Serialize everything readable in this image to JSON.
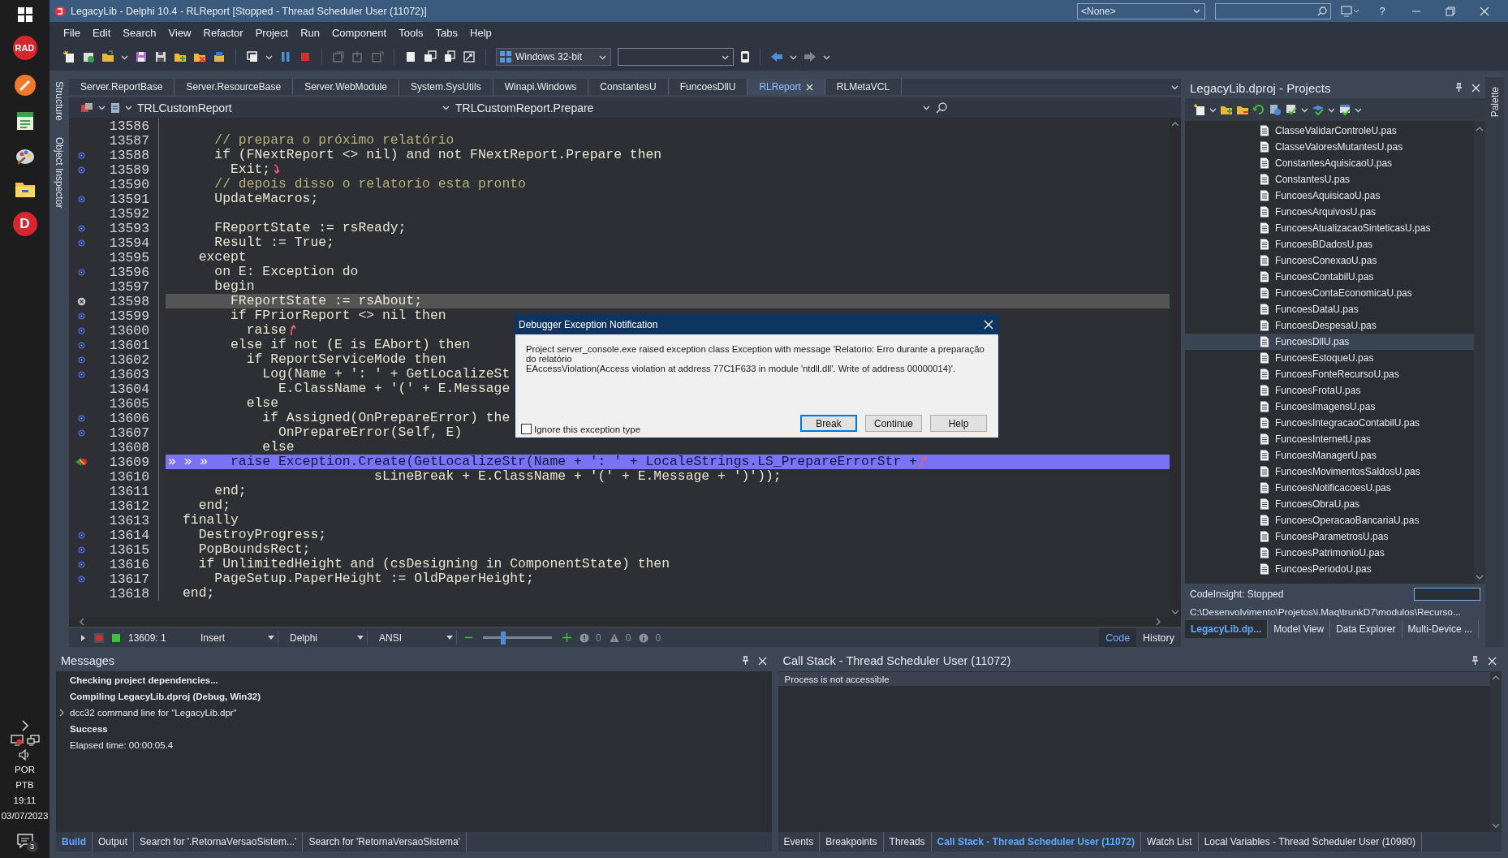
{
  "taskbar": {
    "rad_logo": "RAD",
    "d_logo": "D",
    "language": "POR",
    "region": "PTB",
    "time": "19:11",
    "date": "03/07/2023",
    "notifications": "3"
  },
  "window": {
    "title": "LegacyLib - Delphi 10.4 - RLReport [Stopped - Thread Scheduler User (11072)]",
    "config": "<None>",
    "help": "?"
  },
  "menu": [
    "File",
    "Edit",
    "Search",
    "View",
    "Refactor",
    "Project",
    "Run",
    "Component",
    "Tools",
    "Tabs",
    "Help"
  ],
  "toolbar": {
    "platform": "Windows 32-bit"
  },
  "side_tabs": [
    "Structure",
    "Object Inspector"
  ],
  "editor": {
    "tabs": [
      {
        "label": "Server.ReportBase",
        "selected": false
      },
      {
        "label": "Server.ResourceBase",
        "selected": false
      },
      {
        "label": "Server.WebModule",
        "selected": false
      },
      {
        "label": "System.SysUtils",
        "selected": false
      },
      {
        "label": "Winapi.Windows",
        "selected": false
      },
      {
        "label": "ConstantesU",
        "selected": false
      },
      {
        "label": "FuncoesDllU",
        "selected": false
      },
      {
        "label": "RLReport",
        "selected": true
      },
      {
        "label": "RLMetaVCL",
        "selected": false
      }
    ],
    "class_name": "TRLCustomReport",
    "method": "TRLCustomReport.Prepare",
    "lines": [
      {
        "number": "13586",
        "compiled": false,
        "blocked": false,
        "executing": false,
        "arrow_down": false,
        "arrow_up": false
      },
      {
        "number": "13587",
        "text": "    // prepara o próximo relatório",
        "kind": "comment",
        "compiled": false,
        "blocked": false,
        "executing": false,
        "arrow_down": false,
        "arrow_up": false
      },
      {
        "number": "13588",
        "text": "    if (FNextReport <> nil) and not FNextReport.Prepare then",
        "kind": "code",
        "compiled": true,
        "blocked": false,
        "executing": false,
        "arrow_down": false,
        "arrow_up": false
      },
      {
        "number": "13589",
        "text": "      Exit;",
        "kind": "code",
        "compiled": true,
        "blocked": false,
        "executing": false,
        "arrow_down": true,
        "arrow_up": false
      },
      {
        "number": "13590",
        "text": "    // depois disso o relatorio esta pronto",
        "kind": "comment",
        "compiled": false,
        "blocked": false,
        "executing": false,
        "arrow_down": false,
        "arrow_up": false
      },
      {
        "number": "13591",
        "text": "    UpdateMacros;",
        "kind": "code",
        "compiled": true,
        "blocked": false,
        "executing": false,
        "arrow_down": false,
        "arrow_up": false
      },
      {
        "number": "13592",
        "compiled": false,
        "blocked": false,
        "executing": false,
        "arrow_down": false,
        "arrow_up": false
      },
      {
        "number": "13593",
        "text": "    FReportState := rsReady;",
        "kind": "code",
        "compiled": true,
        "blocked": false,
        "executing": false,
        "arrow_down": false,
        "arrow_up": false
      },
      {
        "number": "13594",
        "text": "    Result := True;",
        "kind": "code",
        "compiled": true,
        "blocked": false,
        "executing": false,
        "arrow_down": false,
        "arrow_up": false
      },
      {
        "number": "13595",
        "text": "  except",
        "kind": "code",
        "compiled": false,
        "blocked": false,
        "executing": false,
        "arrow_down": false,
        "arrow_up": false
      },
      {
        "number": "13596",
        "text": "    on E: Exception do",
        "kind": "code",
        "compiled": true,
        "blocked": false,
        "executing": false,
        "arrow_down": false,
        "arrow_up": false
      },
      {
        "number": "13597",
        "text": "    begin",
        "kind": "code",
        "compiled": false,
        "blocked": false,
        "executing": false,
        "arrow_down": false,
        "arrow_up": false
      },
      {
        "number": "13598",
        "text": "      FReportState := rsAbout;",
        "kind": "code",
        "compiled": false,
        "blocked": true,
        "executing": false,
        "arrow_down": false,
        "arrow_up": false
      },
      {
        "number": "13599",
        "text": "      if FPriorReport <> nil then",
        "kind": "code",
        "compiled": true,
        "blocked": false,
        "executing": false,
        "arrow_down": false,
        "arrow_up": false
      },
      {
        "number": "13600",
        "text": "        raise",
        "kind": "code",
        "compiled": true,
        "blocked": false,
        "executing": false,
        "arrow_down": false,
        "arrow_up": true
      },
      {
        "number": "13601",
        "text": "      else if not (E is EAbort) then",
        "kind": "code",
        "compiled": true,
        "blocked": false,
        "executing": false,
        "arrow_down": false,
        "arrow_up": false
      },
      {
        "number": "13602",
        "text": "        if ReportServiceMode then",
        "kind": "code",
        "compiled": true,
        "blocked": false,
        "executing": false,
        "arrow_down": false,
        "arrow_up": false
      },
      {
        "number": "13603",
        "text": "          Log(Name + ': ' + GetLocalizeSt",
        "kind": "code",
        "compiled": true,
        "blocked": false,
        "executing": false,
        "arrow_down": false,
        "arrow_up": false
      },
      {
        "number": "13604",
        "text": "            E.ClassName + '(' + E.Message",
        "kind": "code",
        "compiled": false,
        "blocked": false,
        "executing": false,
        "arrow_down": false,
        "arrow_up": false
      },
      {
        "number": "13605",
        "text": "        else",
        "kind": "code",
        "compiled": false,
        "blocked": false,
        "executing": false,
        "arrow_down": false,
        "arrow_up": false
      },
      {
        "number": "13606",
        "text": "          if Assigned(OnPrepareError) the",
        "kind": "code",
        "compiled": true,
        "blocked": false,
        "executing": false,
        "arrow_down": false,
        "arrow_up": false
      },
      {
        "number": "13607",
        "text": "            OnPrepareError(Self, E)",
        "kind": "code",
        "compiled": true,
        "blocked": false,
        "executing": false,
        "arrow_down": false,
        "arrow_up": false
      },
      {
        "number": "13608",
        "text": "          else",
        "kind": "code",
        "compiled": false,
        "blocked": false,
        "executing": false,
        "arrow_down": false,
        "arrow_up": false
      },
      {
        "number": "13609",
        "text": "      raise Exception.Create(GetLocalizeStr(Name + ': ' + LocaleStrings.LS_PrepareErrorStr +",
        "kind": "code",
        "compiled": false,
        "blocked": false,
        "executing": true,
        "arrow_down": false,
        "arrow_up": true,
        "tab_marks": "» » »"
      },
      {
        "number": "13610",
        "text": "                        sLineBreak + E.ClassName + '(' + E.Message + ')'));",
        "kind": "code",
        "compiled": false,
        "blocked": false,
        "executing": false,
        "arrow_down": false,
        "arrow_up": false
      },
      {
        "number": "13611",
        "text": "    end;",
        "kind": "code",
        "compiled": false,
        "blocked": false,
        "executing": false,
        "arrow_down": false,
        "arrow_up": false
      },
      {
        "number": "13612",
        "text": "  end;",
        "kind": "code",
        "compiled": false,
        "blocked": false,
        "executing": false,
        "arrow_down": false,
        "arrow_up": false
      },
      {
        "number": "13613",
        "text": "finally",
        "kind": "code",
        "compiled": false,
        "blocked": false,
        "executing": false,
        "arrow_down": false,
        "arrow_up": false
      },
      {
        "number": "13614",
        "text": "  DestroyProgress;",
        "kind": "code",
        "compiled": true,
        "blocked": false,
        "executing": false,
        "arrow_down": false,
        "arrow_up": false
      },
      {
        "number": "13615",
        "text": "  PopBoundsRect;",
        "kind": "code",
        "compiled": true,
        "blocked": false,
        "executing": false,
        "arrow_down": false,
        "arrow_up": false
      },
      {
        "number": "13616",
        "text": "  if UnlimitedHeight and (csDesigning in ComponentState) then",
        "kind": "code",
        "compiled": true,
        "blocked": false,
        "executing": false,
        "arrow_down": false,
        "arrow_up": false
      },
      {
        "number": "13617",
        "text": "    PageSetup.PaperHeight := OldPaperHeight;",
        "kind": "code",
        "compiled": true,
        "blocked": false,
        "executing": false,
        "arrow_down": false,
        "arrow_up": false
      },
      {
        "number": "13618",
        "text": "end;",
        "kind": "code",
        "compiled": false,
        "blocked": false,
        "executing": false,
        "arrow_down": false,
        "arrow_up": false
      }
    ],
    "status": {
      "position": "13609: 1",
      "mode": "Insert",
      "language": "Delphi",
      "encoding": "ANSI",
      "zoom": {
        "level": 0.27
      },
      "counts": [
        {
          "kind": "error",
          "count": "0"
        },
        {
          "kind": "warning",
          "count": "0"
        },
        {
          "kind": "info",
          "count": "0"
        }
      ],
      "views": [
        {
          "label": "Code",
          "selected": true
        },
        {
          "label": "History",
          "selected": false
        }
      ]
    }
  },
  "dialog": {
    "title": "Debugger Exception Notification",
    "message": [
      "Project server_console.exe raised exception class Exception with message 'Relatorio: Erro durante a preparação do relatório",
      "EAccessViolation(Access violation at address 77C1F633 in module 'ntdll.dll'. Write of address 00000014)'."
    ],
    "checkbox": {
      "label": "Ignore this exception type",
      "checked": false
    },
    "buttons": [
      {
        "label": "Break",
        "default": true
      },
      {
        "label": "Continue",
        "default": false
      },
      {
        "label": "Help",
        "default": false
      }
    ]
  },
  "projects": {
    "title": "LegacyLib.dproj - Projects",
    "files": [
      {
        "name": "ClasseValidarControleU.pas",
        "selected": false
      },
      {
        "name": "ClasseValoresMutantesU.pas",
        "selected": false
      },
      {
        "name": "ConstantesAquisicaoU.pas",
        "selected": false
      },
      {
        "name": "ConstantesU.pas",
        "selected": false
      },
      {
        "name": "FuncoesAquisicaoU.pas",
        "selected": false
      },
      {
        "name": "FuncoesArquivosU.pas",
        "selected": false
      },
      {
        "name": "FuncoesAtualizacaoSinteticasU.pas",
        "selected": false
      },
      {
        "name": "FuncoesBDadosU.pas",
        "selected": false
      },
      {
        "name": "FuncoesConexaoU.pas",
        "selected": false
      },
      {
        "name": "FuncoesContabilU.pas",
        "selected": false
      },
      {
        "name": "FuncoesContaEconomicaU.pas",
        "selected": false
      },
      {
        "name": "FuncoesDataU.pas",
        "selected": false
      },
      {
        "name": "FuncoesDespesaU.pas",
        "selected": false
      },
      {
        "name": "FuncoesDllU.pas",
        "selected": true
      },
      {
        "name": "FuncoesEstoqueU.pas",
        "selected": false
      },
      {
        "name": "FuncoesFonteRecursoU.pas",
        "selected": false
      },
      {
        "name": "FuncoesFrotaU.pas",
        "selected": false
      },
      {
        "name": "FuncoesImagensU.pas",
        "selected": false
      },
      {
        "name": "FuncoesIntegracaoContabilU.pas",
        "selected": false
      },
      {
        "name": "FuncoesInternetU.pas",
        "selected": false
      },
      {
        "name": "FuncoesManagerU.pas",
        "selected": false
      },
      {
        "name": "FuncoesMovimentosSaldosU.pas",
        "selected": false
      },
      {
        "name": "FuncoesNotificacoesU.pas",
        "selected": false
      },
      {
        "name": "FuncoesObraU.pas",
        "selected": false
      },
      {
        "name": "FuncoesOperacaoBancariaU.pas",
        "selected": false
      },
      {
        "name": "FuncoesParametrosU.pas",
        "selected": false
      },
      {
        "name": "FuncoesPatrimonioU.pas",
        "selected": false
      },
      {
        "name": "FuncoesPeriodoU.pas",
        "selected": false
      }
    ],
    "codeinsight": "CodeInsight: Stopped",
    "path": "C:\\Desenvolvimento\\Projetos\\i.Maq\\trunkD7\\modulos\\Recurso...",
    "tabs": [
      {
        "label": "LegacyLib.dp...",
        "selected": true
      },
      {
        "label": "Model View",
        "selected": false
      },
      {
        "label": "Data Explorer",
        "selected": false
      },
      {
        "label": "Multi-Device ...",
        "selected": false
      }
    ]
  },
  "palette": "Palette",
  "messages": {
    "title": "Messages",
    "lines": [
      {
        "text": "Checking project dependencies...",
        "bold": true,
        "expandable": false
      },
      {
        "text": "Compiling LegacyLib.dproj (Debug, Win32)",
        "bold": true,
        "expandable": false
      },
      {
        "text": "dcc32 command line for \"LegacyLib.dpr\"",
        "bold": false,
        "expandable": true
      },
      {
        "text": "Success",
        "bold": true,
        "expandable": false
      },
      {
        "text": "Elapsed time: 00:00:05.4",
        "bold": false,
        "expandable": false
      }
    ],
    "tabs": [
      {
        "label": "Build",
        "selected": true
      },
      {
        "label": "Output",
        "selected": false
      },
      {
        "label": "Search for '.RetornaVersaoSistem...'",
        "selected": false
      },
      {
        "label": "Search for 'RetornaVersaoSistema'",
        "selected": false
      }
    ]
  },
  "call_stack": {
    "title": "Call Stack - Thread Scheduler User (11072)",
    "rows": [
      {
        "text": "Process is not accessible",
        "selected": true
      }
    ],
    "tabs": [
      {
        "label": "Events",
        "selected": false
      },
      {
        "label": "Breakpoints",
        "selected": false
      },
      {
        "label": "Threads",
        "selected": false
      },
      {
        "label": "Call Stack - Thread Scheduler User (11072)",
        "selected": true
      },
      {
        "label": "Watch List",
        "selected": false
      },
      {
        "label": "Local Variables - Thread Scheduler User (10980)",
        "selected": false
      }
    ]
  }
}
